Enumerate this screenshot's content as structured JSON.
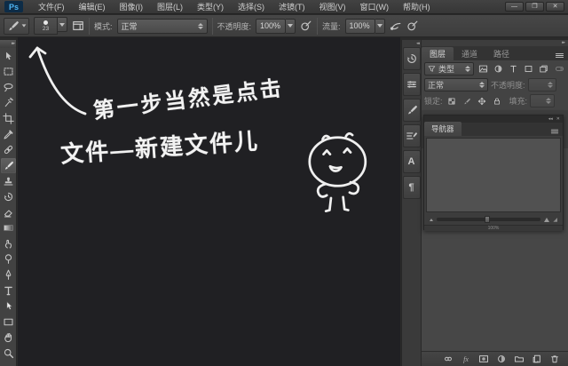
{
  "window": {
    "minimize": "—",
    "maximize": "❐",
    "close": "✕",
    "collapse_glyph": "◂◂",
    "menu_glyph": "☰"
  },
  "menu": {
    "logo": "Ps",
    "items": [
      "文件(F)",
      "编辑(E)",
      "图像(I)",
      "图层(L)",
      "类型(Y)",
      "选择(S)",
      "滤镜(T)",
      "视图(V)",
      "窗口(W)",
      "帮助(H)"
    ]
  },
  "options": {
    "brush_size": "23",
    "mode_label": "模式:",
    "mode_value": "正常",
    "opacity_label": "不透明度:",
    "opacity_value": "100%",
    "flow_label": "流量:",
    "flow_value": "100%"
  },
  "tools": {
    "selected": "brush",
    "list": [
      "move",
      "rectangular-marquee",
      "lasso",
      "magic-wand",
      "crop",
      "eyedropper",
      "healing-brush",
      "brush",
      "clone-stamp",
      "history-brush",
      "eraser",
      "gradient",
      "smudge",
      "dodge",
      "pen",
      "type",
      "path-selection",
      "rectangle-shape",
      "hand",
      "zoom"
    ]
  },
  "canvas": {
    "handwriting_line1": "第一步当然是点击",
    "handwriting_line2": "文件—新建文件儿"
  },
  "dock": {
    "panels": [
      "history",
      "properties",
      "brush",
      "brush-presets",
      "character",
      "paragraph"
    ],
    "character_glyph": "A",
    "paragraph_glyph": "¶"
  },
  "layers_panel": {
    "tabs": [
      "图层",
      "通道",
      "路径"
    ],
    "active_tab": "图层",
    "filter_label": "类型",
    "blend_mode": "正常",
    "opacity_label": "不透明度:",
    "lock_label": "锁定:",
    "fill_label": "填充:",
    "fx_glyph": "fx"
  },
  "navigator_panel": {
    "tab": "导航器",
    "zoom_value": "100%"
  },
  "colors": {
    "accent_blue": "#4fb6f5",
    "chrome": "#3d3d3d",
    "canvas_bg": "#202023",
    "ink": "#f2f2f2"
  }
}
